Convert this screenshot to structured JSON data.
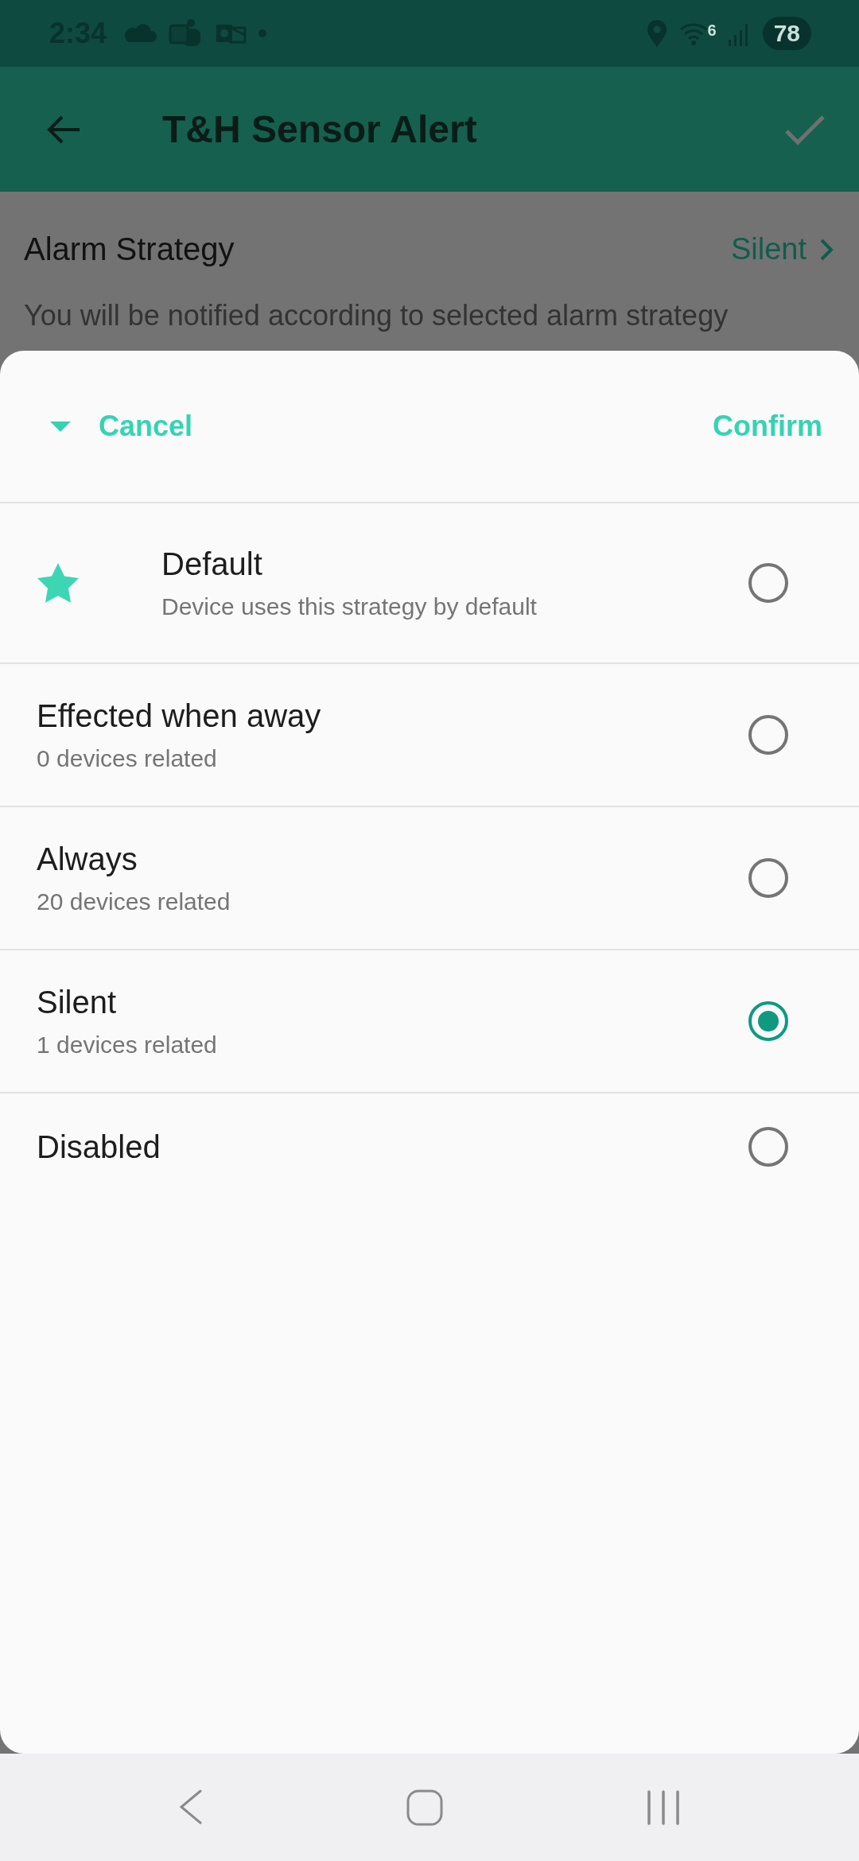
{
  "status_bar": {
    "time": "2:34",
    "wifi_badge": "6",
    "battery": "78"
  },
  "app_bar": {
    "title": "T&H Sensor Alert"
  },
  "setting": {
    "label": "Alarm Strategy",
    "value": "Silent",
    "description": "You will be notified according to selected alarm strategy"
  },
  "sheet": {
    "cancel": "Cancel",
    "confirm": "Confirm",
    "options": [
      {
        "kind": "starred",
        "title": "Default",
        "subtitle": "Device uses this strategy by default",
        "selected": false
      },
      {
        "kind": "plain",
        "title": "Effected when away",
        "subtitle": "0 devices related",
        "selected": false
      },
      {
        "kind": "plain",
        "title": "Always",
        "subtitle": "20 devices related",
        "selected": false
      },
      {
        "kind": "plain",
        "title": "Silent",
        "subtitle": "1 devices related",
        "selected": true
      },
      {
        "kind": "plain",
        "title": "Disabled",
        "selected": false
      }
    ]
  }
}
